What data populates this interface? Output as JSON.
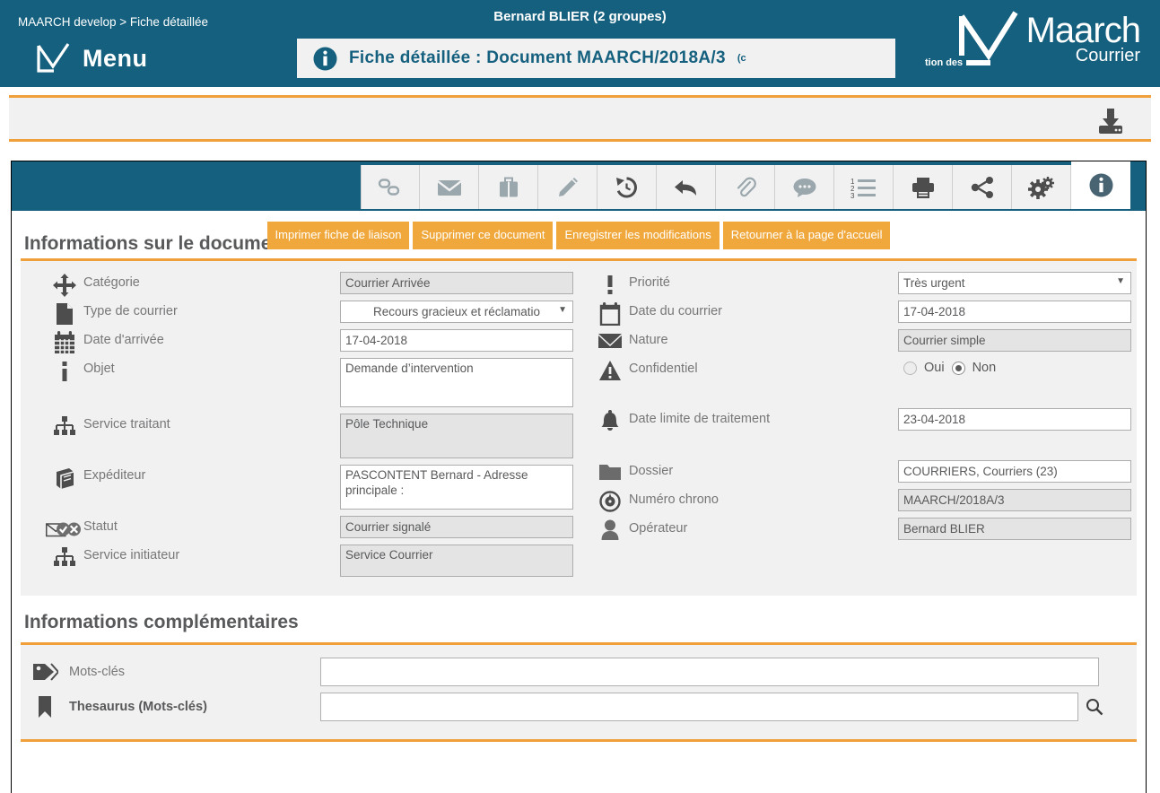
{
  "header": {
    "breadcrumb": "MAARCH develop > Fiche détaillée",
    "menu_label": "Menu",
    "menu_icon": "maarch-checkmark-logo",
    "user": "Bernard BLIER (2 groupes)",
    "tab_icon": "info-icon",
    "tab_title": "Fiche détaillée : Document MAARCH/2018A/3",
    "tab_title_suffix": "(c",
    "ghost_text": "tion des",
    "brand_name": "Maarch",
    "brand_sub": "Courrier",
    "brand_icon": "maarch-checkmark-logo"
  },
  "subbar": {
    "download_icon": "download-icon"
  },
  "toolbar": {
    "tabs": [
      {
        "name": "link-icon",
        "icon": "link",
        "active": false
      },
      {
        "name": "envelope-icon",
        "icon": "envelope",
        "active": false
      },
      {
        "name": "briefcase-icon",
        "icon": "briefcase",
        "active": false
      },
      {
        "name": "pencil-icon",
        "icon": "pencil",
        "active": false
      },
      {
        "name": "history-icon",
        "icon": "history",
        "active": false
      },
      {
        "name": "reply-icon",
        "icon": "reply",
        "active": false
      },
      {
        "name": "paperclip-icon",
        "icon": "paperclip",
        "active": false
      },
      {
        "name": "comment-icon",
        "icon": "comment",
        "active": false
      },
      {
        "name": "numbered-list-icon",
        "icon": "list",
        "active": false
      },
      {
        "name": "printer-icon",
        "icon": "printer",
        "active": false
      },
      {
        "name": "share-icon",
        "icon": "share",
        "active": false
      },
      {
        "name": "gears-icon",
        "icon": "gears",
        "active": false
      },
      {
        "name": "info-icon",
        "icon": "info",
        "active": true
      }
    ]
  },
  "actions": [
    {
      "label": "Imprimer fiche de liaison"
    },
    {
      "label": "Supprimer ce document"
    },
    {
      "label": "Enregistrer les modifications"
    },
    {
      "label": "Retourner à la page d'accueil"
    }
  ],
  "doc_section": {
    "title": "Informations sur le document",
    "left": [
      {
        "icon": "move-arrows-icon",
        "label": "Catégorie",
        "type": "text",
        "value": "Courrier Arrivée",
        "readonly": true
      },
      {
        "icon": "document-icon",
        "label": "Type de courrier",
        "type": "select",
        "value": "Recours gracieux et réclamatio",
        "readonly": false
      },
      {
        "icon": "calendar-icon",
        "label": "Date d'arrivée",
        "type": "text",
        "value": "17-04-2018",
        "readonly": false
      },
      {
        "icon": "info-i-icon",
        "label": "Objet",
        "type": "textarea",
        "value": "Demande d’intervention",
        "readonly": false,
        "size": "tall"
      },
      {
        "icon": "org-chart-icon",
        "label": "Service traitant",
        "type": "textarea",
        "value": "Pôle Technique",
        "readonly": true,
        "size": "mid"
      },
      {
        "icon": "book-icon",
        "label": "Expéditeur",
        "type": "textarea",
        "value": "PASCONTENT Bernard - Adresse principale :",
        "readonly": false,
        "size": "mid"
      },
      {
        "icon": "mail-status-icon",
        "label": "Statut",
        "type": "text",
        "value": "Courrier signalé",
        "readonly": true
      },
      {
        "icon": "org-chart-icon",
        "label": "Service initiateur",
        "type": "textarea",
        "value": "Service Courrier",
        "readonly": true,
        "size": "short"
      }
    ],
    "right": [
      {
        "icon": "exclamation-icon",
        "label": "Priorité",
        "type": "select",
        "value": "Très urgent",
        "readonly": false
      },
      {
        "icon": "calendar-icon",
        "label": "Date du courrier",
        "type": "text",
        "value": "17-04-2018",
        "readonly": false
      },
      {
        "icon": "envelope-icon",
        "label": "Nature",
        "type": "text",
        "value": "Courrier simple",
        "readonly": true
      },
      {
        "icon": "warning-icon",
        "label": "Confidentiel",
        "type": "radio",
        "options": [
          "Oui",
          "Non"
        ],
        "selected": "Non"
      },
      {
        "icon": "bell-icon",
        "label": "Date limite de traitement",
        "type": "text",
        "value": "23-04-2018",
        "readonly": false
      },
      {
        "icon": "folder-icon",
        "label": "Dossier",
        "type": "text",
        "value": "COURRIERS, Courriers (23)",
        "readonly": false
      },
      {
        "icon": "compass-icon",
        "label": "Numéro chrono",
        "type": "text",
        "value": "MAARCH/2018A/3",
        "readonly": true
      },
      {
        "icon": "user-icon",
        "label": "Opérateur",
        "type": "text",
        "value": "Bernard BLIER",
        "readonly": true
      }
    ]
  },
  "extra_section": {
    "title": "Informations complémentaires",
    "rows": [
      {
        "icon": "tag-icon",
        "label": "Mots-clés",
        "value": "",
        "placeholder": "",
        "bold": false,
        "search": false
      },
      {
        "icon": "bookmark-icon",
        "label": "Thesaurus (Mots-clés)",
        "value": "",
        "placeholder": "",
        "bold": true,
        "search": true
      }
    ],
    "search_icon": "search-icon"
  },
  "colors": {
    "teal": "#14607e",
    "orange": "#f0a03a",
    "button_orange": "#f0a83c",
    "panel_grey": "#f1f1f1",
    "readonly_grey": "#e4e4e4",
    "text_grey": "#58595b"
  }
}
